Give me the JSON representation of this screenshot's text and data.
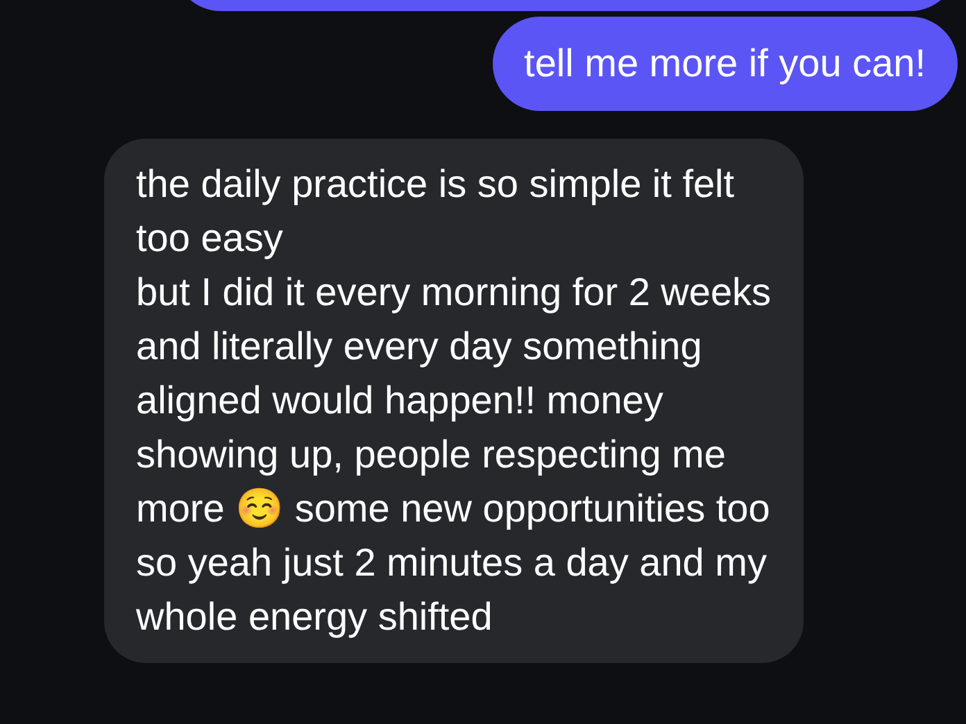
{
  "messages": [
    {
      "outgoing": true,
      "lines": [
        "tell me more if you can!"
      ]
    },
    {
      "outgoing": false,
      "lines": [
        "the daily practice is so simple it felt too easy",
        "but I did it every morning for 2 weeks",
        "and literally every day something aligned would happen!! money showing up, people respecting me more ☺️ some new opportunities too so yeah just 2 minutes a day and my whole energy shifted"
      ]
    }
  ]
}
